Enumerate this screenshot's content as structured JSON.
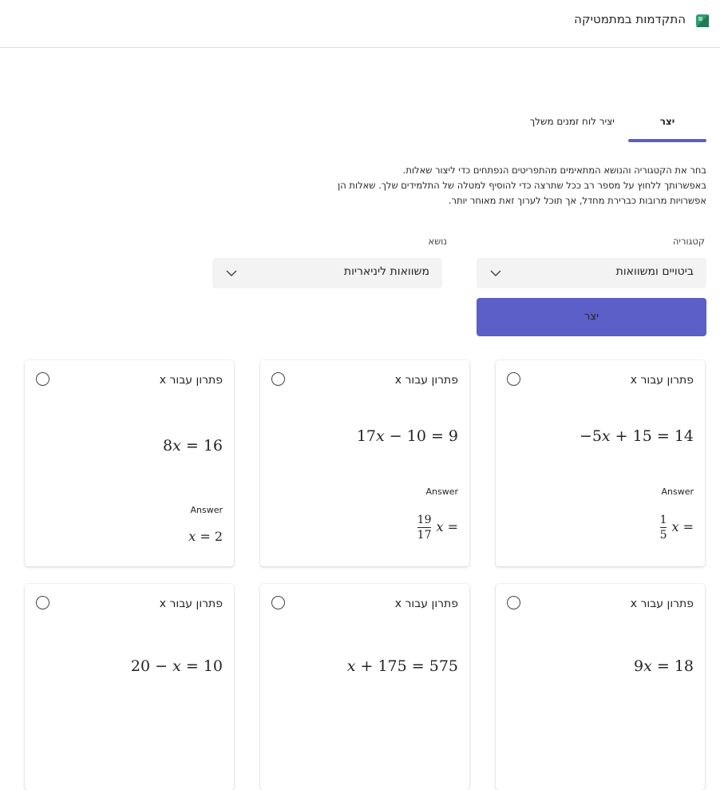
{
  "app": {
    "title": "התקדמות במתמטיקה",
    "icon": "app-icon"
  },
  "tabs": [
    {
      "label": "יצר"
    },
    {
      "label": "יציר לוח זמנים משלך"
    }
  ],
  "description": [
    "בחר את הקטגוריה והנושא המתאימים מהתפריטים הנפתחים כדי ליצור שאלות.",
    "באפשרותך ללחוץ על מספר רב ככל שתרצה כדי להוסיף למטלה של התלמידים שלך. שאלות הן",
    "אפשרויות מרובות כברירת מחדל, אך תוכל לערוך זאת מאוחר יותר."
  ],
  "form": {
    "category_label": "קטגוריה",
    "topic_label": "נושא",
    "category_value": "ביטויים ומשוואות",
    "topic_value": "משוואות ליניאריות",
    "generate_button": "יצר"
  },
  "cards": [
    {
      "title": "פתרון עבור x",
      "equation": "−5𝑥 + 15 = 14",
      "answer_label": "Answer",
      "answer_lhs": "𝑥 =",
      "answer_num": "1",
      "answer_den": "5"
    },
    {
      "title": "פתרון עבור x",
      "equation": "17𝑥 − 10 = 9",
      "answer_label": "Answer",
      "answer_lhs": "𝑥 =",
      "answer_num": "19",
      "answer_den": "17"
    },
    {
      "title": "פתרון עבור x",
      "equation": "8𝑥 = 16",
      "answer_label": "Answer",
      "answer": "𝑥 = 2"
    },
    {
      "title": "פתרון עבור x",
      "equation": "9𝑥 = 18"
    },
    {
      "title": "פתרון עבור x",
      "equation": "𝑥 + 175 = 575"
    },
    {
      "title": "פתרון עבור x",
      "equation": "20 − 𝑥 = 10"
    }
  ]
}
